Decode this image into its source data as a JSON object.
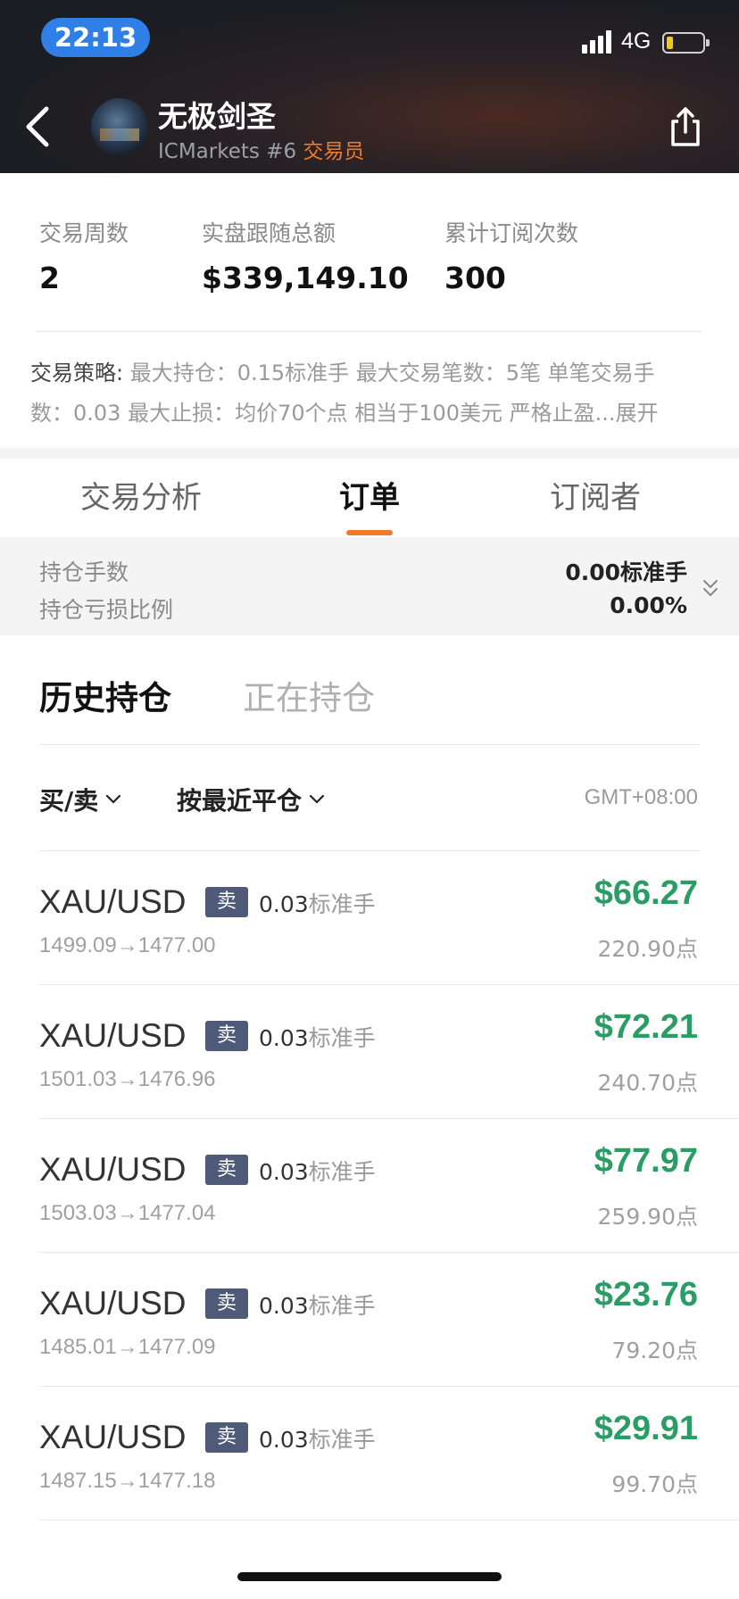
{
  "status_bar": {
    "time": "22:13",
    "network": "4G",
    "battery_level": 0.18
  },
  "header": {
    "trader_name": "无极剑圣",
    "broker": "ICMarkets #6 ",
    "role": "交易员"
  },
  "stats": [
    {
      "label": "交易周数",
      "value": "2"
    },
    {
      "label": "实盘跟随总额",
      "value": "$339,149.10"
    },
    {
      "label": "累计订阅次数",
      "value": "300"
    }
  ],
  "strategy": {
    "label": "交易策略:",
    "line1": " 最大持仓：0.15标准手 最大交易笔数：5笔 单笔交易手",
    "line2": "数：0.03 最大止损：均价70个点 相当于100美元 严格止盈",
    "ellipsis": "...",
    "expand": "展开"
  },
  "tabs": [
    "交易分析",
    "订单",
    "订阅者"
  ],
  "summary": {
    "lots_label": "持仓手数",
    "lots_value": "0.00标准手",
    "pnl_label": "持仓亏损比例",
    "pnl_value": "0.00%"
  },
  "subtabs": {
    "history": "历史持仓",
    "open": "正在持仓"
  },
  "filters": {
    "side": "买/卖",
    "sort": "按最近平仓",
    "timezone": "GMT+08:00"
  },
  "orders": [
    {
      "symbol": "XAU/USD",
      "side": "卖",
      "lots": "0.03",
      "unit": "标准手",
      "prices": "1499.09→1477.00",
      "profit": "$66.27",
      "points": "220.90点"
    },
    {
      "symbol": "XAU/USD",
      "side": "卖",
      "lots": "0.03",
      "unit": "标准手",
      "prices": "1501.03→1476.96",
      "profit": "$72.21",
      "points": "240.70点"
    },
    {
      "symbol": "XAU/USD",
      "side": "卖",
      "lots": "0.03",
      "unit": "标准手",
      "prices": "1503.03→1477.04",
      "profit": "$77.97",
      "points": "259.90点"
    },
    {
      "symbol": "XAU/USD",
      "side": "卖",
      "lots": "0.03",
      "unit": "标准手",
      "prices": "1485.01→1477.09",
      "profit": "$23.76",
      "points": "79.20点"
    },
    {
      "symbol": "XAU/USD",
      "side": "卖",
      "lots": "0.03",
      "unit": "标准手",
      "prices": "1487.15→1477.18",
      "profit": "$29.91",
      "points": "99.70点"
    }
  ],
  "colors": {
    "accent": "#f07a2a",
    "profit": "#2a9d64",
    "badge": "#4f5a78"
  }
}
